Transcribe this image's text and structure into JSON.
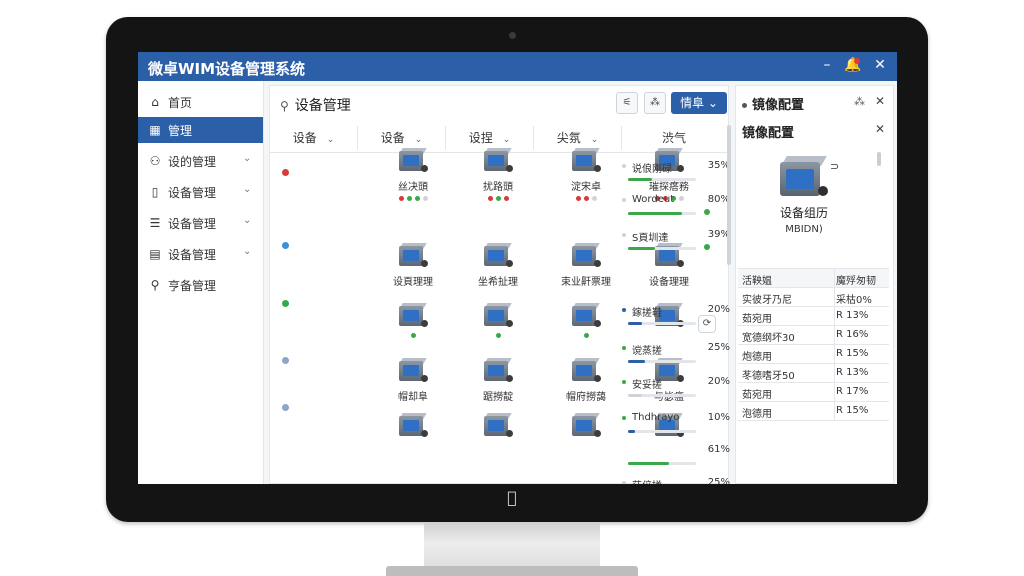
{
  "app": {
    "title": "微卓WIM设备管理系统",
    "window_controls": {
      "minimize": "–",
      "notify": "🔔",
      "close": "✕"
    },
    "accent_color": "#2b5fa7"
  },
  "sidebar": {
    "items": [
      {
        "icon": "⌂",
        "label": "首页",
        "chevron": ""
      },
      {
        "icon": "▦",
        "label": "管理",
        "chevron": ""
      },
      {
        "icon": "⚇",
        "label": "设的管理",
        "chevron": "⌄"
      },
      {
        "icon": "▯",
        "label": "设备管理",
        "chevron": "⌄"
      },
      {
        "icon": "☰",
        "label": "设备管理",
        "chevron": "⌄"
      },
      {
        "icon": "▤",
        "label": "设备管理",
        "chevron": "⌄"
      },
      {
        "icon": "⚲",
        "label": "亨备管理",
        "chevron": ""
      }
    ]
  },
  "main": {
    "title": "设备管理",
    "title_icon": "⚲",
    "toolbar": {
      "btn1": "⚟",
      "btn2": "⁂",
      "details": "情阜 ⌄"
    },
    "columns": [
      {
        "label": "设备",
        "chevron": "⌄"
      },
      {
        "label": "设备",
        "chevron": "⌄"
      },
      {
        "label": "设捏",
        "chevron": "⌄"
      },
      {
        "label": "尖氛",
        "chevron": "⌄"
      },
      {
        "label": "渋气",
        "chevron": ""
      }
    ],
    "rows": [
      {
        "status_color": "#d83a3a",
        "devices": [
          {
            "label": "丝决頭",
            "dots": [
              "#d83a3a",
              "#3aa849",
              "#3aa849",
              "#cfd3d8"
            ]
          },
          {
            "label": "扰路頭",
            "dots": [
              "#d83a3a",
              "#3aa849",
              "#d83a3a"
            ]
          },
          {
            "label": "淀宋卓",
            "dots": [
              "#d83a3a",
              "#d83a3a",
              "#cfd3d8"
            ]
          },
          {
            "label": "璀探瘩務",
            "dots": [
              "#d83a3a",
              "#d83a3a",
              "#3aa849",
              "#cfd3d8"
            ]
          }
        ]
      },
      {
        "status_color": "#3b8fd6",
        "devices": [
          {
            "label": "设頁理理",
            "dots": []
          },
          {
            "label": "坐希扯理",
            "dots": []
          },
          {
            "label": "束业鼾票理",
            "dots": []
          },
          {
            "label": "设备理理",
            "dots": []
          }
        ]
      },
      {
        "status_color": "#3aa849",
        "devices": [
          {
            "label": "",
            "dots": [
              "#3aa849"
            ]
          },
          {
            "label": "",
            "dots": [
              "#3aa849"
            ]
          },
          {
            "label": "",
            "dots": [
              "#3aa849"
            ]
          },
          {
            "label": "",
            "dots": []
          }
        ]
      },
      {
        "status_color": "#8aa6c8",
        "devices": [
          {
            "label": "帽却阜",
            "dots": []
          },
          {
            "label": "踞撈靛",
            "dots": []
          },
          {
            "label": "帽府撈藹",
            "dots": []
          },
          {
            "label": "与毖瘟",
            "dots": []
          }
        ]
      },
      {
        "status_color": "#8aa6c8",
        "devices": [
          {
            "label": "",
            "dots": []
          },
          {
            "label": "",
            "dots": []
          },
          {
            "label": "",
            "dots": []
          },
          {
            "label": "",
            "dots": []
          }
        ]
      }
    ],
    "progress": [
      {
        "name": "说俍刚碌",
        "percent": "35%",
        "value": 0.35,
        "color": "#3aa849",
        "bullet": "#cfd3d8",
        "end": ""
      },
      {
        "name": "Wordeut",
        "percent": "80%",
        "value": 0.8,
        "color": "#3aa849",
        "bullet": "#cfd3d8",
        "end": "#3aa849"
      },
      {
        "name": "S頁圳達",
        "percent": "39%",
        "value": 0.39,
        "color": "#3aa849",
        "bullet": "#cfd3d8",
        "end": "#3aa849"
      },
      {
        "name": "鎵搓鞋",
        "percent": "20%",
        "value": 0.2,
        "color": "#2b5fa7",
        "bullet": "#2b5fa7",
        "end": ""
      },
      {
        "name": "谠蒸搓",
        "percent": "25%",
        "value": 0.25,
        "color": "#2b5fa7",
        "bullet": "#3aa849",
        "end": ""
      },
      {
        "name": "安妥搓",
        "percent": "20%",
        "value": 0.2,
        "color": "#cfd3d8",
        "bullet": "#3aa849",
        "end": ""
      },
      {
        "name": "Thdhrayo",
        "percent": "10%",
        "value": 0.1,
        "color": "#2b5fa7",
        "bullet": "#3aa849",
        "end": ""
      },
      {
        "name": "",
        "percent": "61%",
        "value": 0.61,
        "color": "#3aa849",
        "bullet": "",
        "end": ""
      },
      {
        "name": "茫倍搓",
        "percent": "25%",
        "value": 0.25,
        "color": "#2b5fa7",
        "bullet": "#cfd3d8",
        "end": ""
      }
    ],
    "refresh_icon": "⟳"
  },
  "right_panel": {
    "header": "镜像配置",
    "header_icon": "⁂",
    "close": "✕",
    "subheader": "镜像配置",
    "cord": "⊃",
    "device_name": "设备组历",
    "device_id": "MBIDN)",
    "table": {
      "columns": [
        "活鞅媪",
        "魔殍匆韧"
      ],
      "rows": [
        [
          "实彼牙乃尼",
          "采枯0%"
        ],
        [
          "茹宛用",
          "R 13%"
        ],
        [
          "宽德纲坏30",
          "R 16%"
        ],
        [
          "炮德用",
          "R 15%"
        ],
        [
          "苳德嗜牙50",
          "R 13%"
        ],
        [
          "茹宛用",
          "R 17%"
        ],
        [
          "泡德用",
          "R 15%"
        ]
      ]
    }
  }
}
